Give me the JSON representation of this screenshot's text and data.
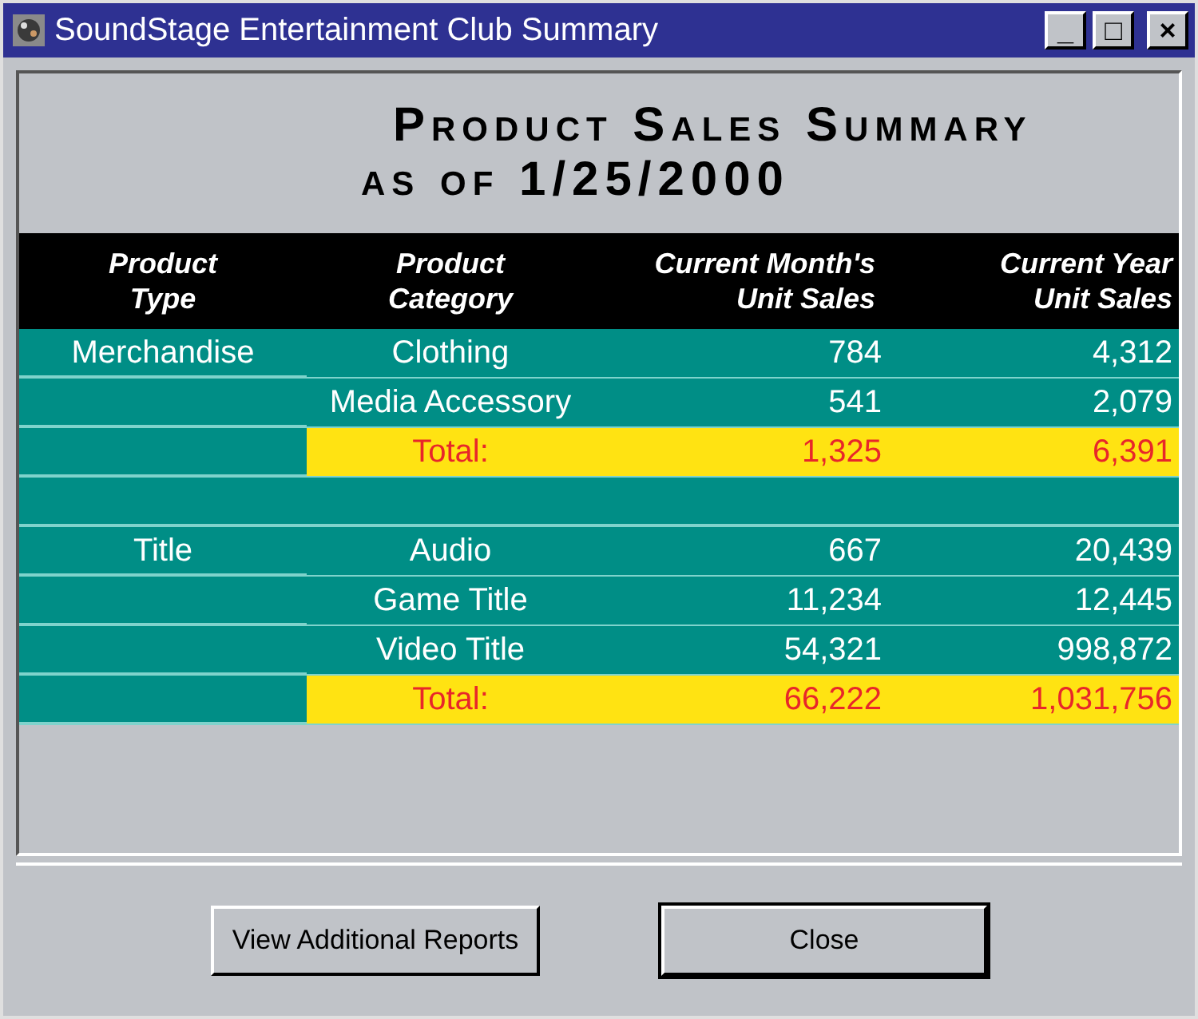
{
  "window": {
    "title": "SoundStage Entertainment Club Summary",
    "controls": [
      "_",
      "□",
      "×"
    ]
  },
  "report": {
    "title": "Product Sales Summary",
    "subtitle": "as of 1/25/2000"
  },
  "table": {
    "columns": [
      {
        "line1": "Product",
        "line2": "Type"
      },
      {
        "line1": "Product",
        "line2": "Category"
      },
      {
        "line1": "Current Month's",
        "line2": "Unit Sales"
      },
      {
        "line1": "Current Year",
        "line2": "Unit Sales"
      }
    ],
    "rows": [
      {
        "kind": "item",
        "type": "Merchandise",
        "category": "Clothing",
        "month": "784",
        "year": "4,312"
      },
      {
        "kind": "item",
        "category": "Media Accessory",
        "month": "541",
        "year": "2,079"
      },
      {
        "kind": "total",
        "category": "Total:",
        "month": "1,325",
        "year": "6,391"
      },
      {
        "kind": "blank"
      },
      {
        "kind": "item",
        "type": "Title",
        "category": "Audio",
        "month": "667",
        "year": "20,439"
      },
      {
        "kind": "item",
        "category": "Game Title",
        "month": "11,234",
        "year": "12,445"
      },
      {
        "kind": "item",
        "category": "Video Title",
        "month": "54,321",
        "year": "998,872"
      },
      {
        "kind": "total",
        "category": "Total:",
        "month": "66,222",
        "year": "1,031,756"
      }
    ]
  },
  "buttons": [
    {
      "label": "View Additional Reports",
      "default": false
    },
    {
      "label": "Close",
      "default": true
    }
  ]
}
